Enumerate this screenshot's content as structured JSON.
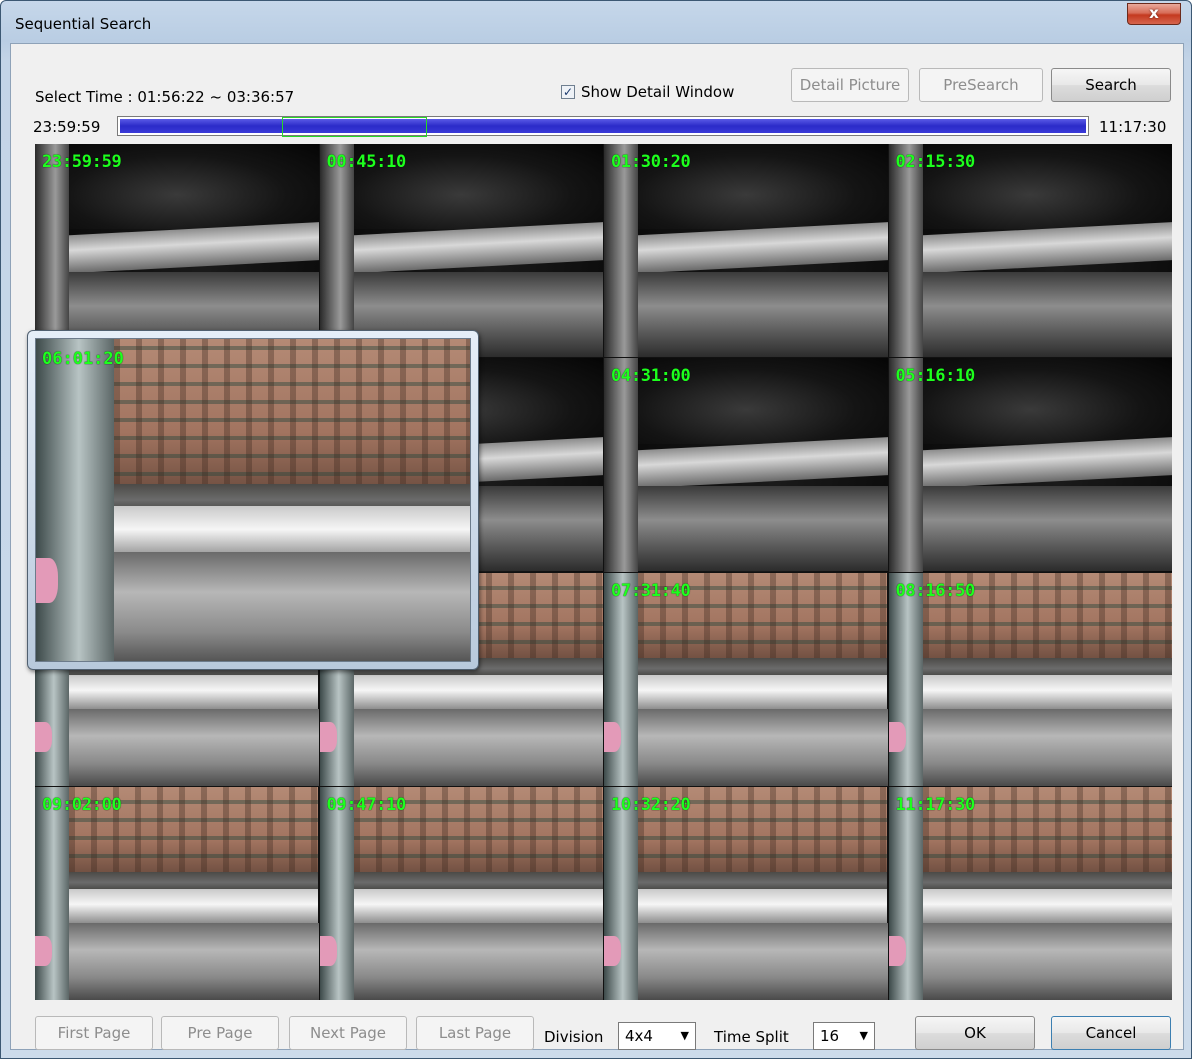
{
  "window": {
    "title": "Sequential Search",
    "close_glyph": "x"
  },
  "header": {
    "select_time_label": "Select Time : 01:56:22 ~ 03:36:57",
    "show_detail_label": "Show Detail Window",
    "show_detail_checked": true,
    "buttons": {
      "detail_picture": "Detail Picture",
      "presearch": "PreSearch",
      "search": "Search"
    }
  },
  "timeline": {
    "start": "23:59:59",
    "end": "11:17:30",
    "selection_range": [
      "01:56:22",
      "03:36:57"
    ]
  },
  "thumbnails": [
    {
      "time": "23:59:59",
      "scene": "night"
    },
    {
      "time": "00:45:10",
      "scene": "night"
    },
    {
      "time": "01:30:20",
      "scene": "night"
    },
    {
      "time": "02:15:30",
      "scene": "night"
    },
    {
      "time": "",
      "scene": "night"
    },
    {
      "time": "",
      "scene": "night"
    },
    {
      "time": "04:31:00",
      "scene": "night"
    },
    {
      "time": "05:16:10",
      "scene": "night"
    },
    {
      "time": "",
      "scene": "day"
    },
    {
      "time": "",
      "scene": "day"
    },
    {
      "time": "07:31:40",
      "scene": "day"
    },
    {
      "time": "08:16:50",
      "scene": "day"
    },
    {
      "time": "09:02:00",
      "scene": "day"
    },
    {
      "time": "09:47:10",
      "scene": "day"
    },
    {
      "time": "10:32:20",
      "scene": "day"
    },
    {
      "time": "11:17:30",
      "scene": "day"
    }
  ],
  "detail_window": {
    "time": "06:01:20"
  },
  "footer": {
    "first_page": "First Page",
    "pre_page": "Pre Page",
    "next_page": "Next Page",
    "last_page": "Last Page",
    "division_label": "Division",
    "division_value": "4x4",
    "time_split_label": "Time Split",
    "time_split_value": "16",
    "ok": "OK",
    "cancel": "Cancel"
  }
}
